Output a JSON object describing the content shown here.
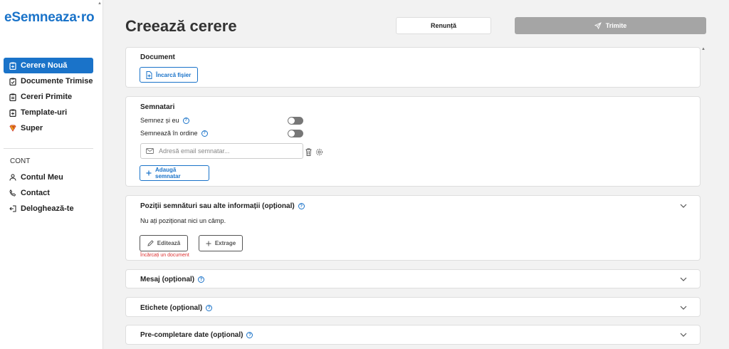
{
  "app": {
    "logo_part1": "eSemneaza",
    "logo_part2": "·ro"
  },
  "sidebar": {
    "items": [
      {
        "label": "Cerere Nouă",
        "icon": "clipboard-icon",
        "active": true
      },
      {
        "label": "Documente Trimise",
        "icon": "clipboard-check-icon",
        "active": false
      },
      {
        "label": "Cereri Primite",
        "icon": "clipboard-list-icon",
        "active": false
      },
      {
        "label": "Template-uri",
        "icon": "clipboard-copy-icon",
        "active": false
      },
      {
        "label": "Super",
        "icon": "superman-icon",
        "active": false
      }
    ],
    "section_label": "CONT",
    "account_items": [
      {
        "label": "Contul Meu",
        "icon": "user-icon"
      },
      {
        "label": "Contact",
        "icon": "phone-icon"
      },
      {
        "label": "Deloghează-te",
        "icon": "logout-icon"
      }
    ]
  },
  "header": {
    "title": "Creează cerere",
    "cancel_label": "Renunță",
    "send_label": "Trimite"
  },
  "document": {
    "title": "Document",
    "upload_label": "Încarcă fișier"
  },
  "signers": {
    "title": "Semnatari",
    "sign_self_label": "Semnez și eu",
    "sign_order_label": "Semnează în ordine",
    "email_placeholder": "Adresă email semnatar...",
    "add_signer_label": "Adaugă semnatar"
  },
  "positions": {
    "title": "Poziții semnături sau alte informații (opțional)",
    "empty_text": "Nu ați poziționat nici un câmp.",
    "edit_label": "Editează",
    "extract_label": "Extrage",
    "error_text": "Încărcați un document"
  },
  "message": {
    "title": "Mesaj (opțional)"
  },
  "labels": {
    "title": "Etichete (opțional)"
  },
  "prefill": {
    "title": "Pre-completare date (opțional)"
  },
  "colors": {
    "accent": "#1a73c9",
    "send_disabled": "#a5a5a5",
    "error": "#dd3333"
  }
}
